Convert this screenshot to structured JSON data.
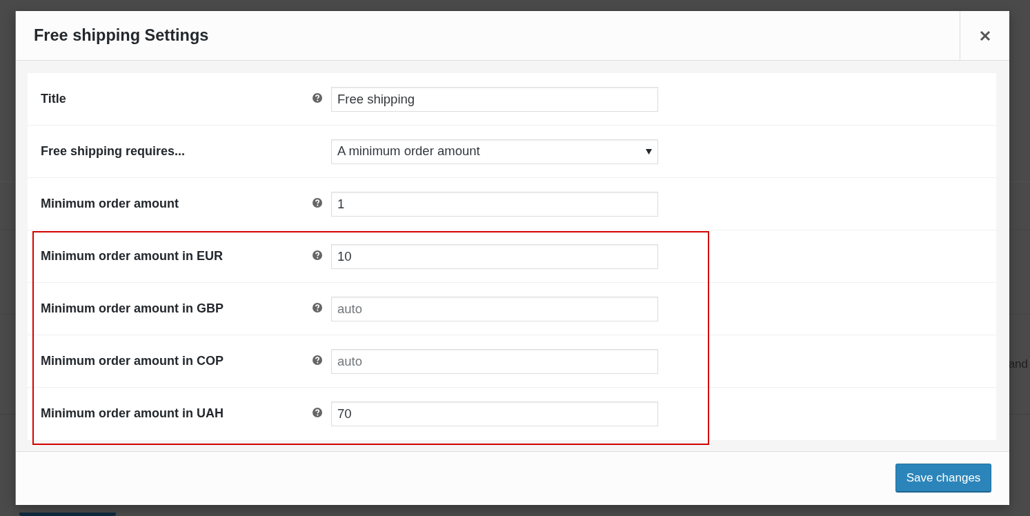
{
  "background": {
    "text": "and"
  },
  "dialog": {
    "title": "Free shipping Settings"
  },
  "fields": [
    {
      "kind": "text",
      "label": "Title",
      "help": true,
      "highlighted": false,
      "value": "Free shipping"
    },
    {
      "kind": "select",
      "label": "Free shipping requires...",
      "help": false,
      "highlighted": false,
      "value": "A minimum order amount"
    },
    {
      "kind": "text",
      "label": "Minimum order amount",
      "help": true,
      "highlighted": false,
      "value": "1"
    },
    {
      "kind": "text",
      "label": "Minimum order amount in EUR",
      "help": true,
      "highlighted": true,
      "value": "10"
    },
    {
      "kind": "text",
      "label": "Minimum order amount in GBP",
      "help": true,
      "highlighted": true,
      "placeholder": "auto"
    },
    {
      "kind": "text",
      "label": "Minimum order amount in COP",
      "help": true,
      "highlighted": true,
      "placeholder": "auto"
    },
    {
      "kind": "text",
      "label": "Minimum order amount in UAH",
      "help": true,
      "highlighted": true,
      "value": "70"
    }
  ],
  "footer": {
    "save_button": "Save changes"
  }
}
